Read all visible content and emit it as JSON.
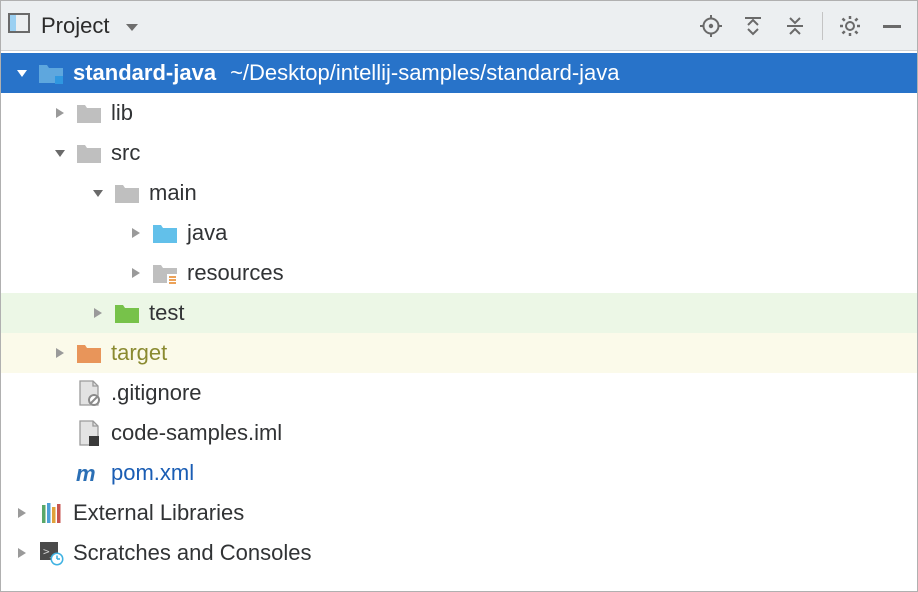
{
  "header": {
    "title": "Project"
  },
  "icons": {
    "gear": "gear-icon",
    "minimize": "minimize-icon",
    "target": "target-icon",
    "expand_all": "expand-all-icon",
    "collapse_all": "collapse-all-icon"
  },
  "tree": {
    "project": {
      "name": "standard-java",
      "path": "~/Desktop/intellij-samples/standard-java"
    },
    "lib": {
      "name": "lib"
    },
    "src": {
      "name": "src"
    },
    "main": {
      "name": "main"
    },
    "java": {
      "name": "java"
    },
    "resources": {
      "name": "resources"
    },
    "test": {
      "name": "test"
    },
    "target": {
      "name": "target"
    },
    "gitignore": {
      "name": ".gitignore"
    },
    "iml": {
      "name": "code-samples.iml"
    },
    "pom": {
      "name": "pom.xml"
    },
    "extlib": {
      "name": "External Libraries"
    },
    "scratches": {
      "name": "Scratches and Consoles"
    }
  }
}
